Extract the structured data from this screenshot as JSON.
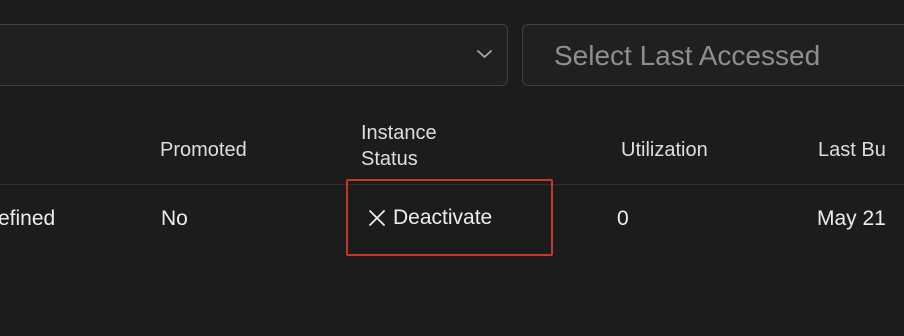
{
  "filters": {
    "first_select": {
      "value": "",
      "icon": "chevron-down-icon"
    },
    "last_accessed": {
      "placeholder": "Select Last Accessed"
    }
  },
  "table": {
    "columns": {
      "promoted": "Promoted",
      "instance_status_line1": "Instance",
      "instance_status_line2": "Status",
      "utilization": "Utilization",
      "last_built": "Last Bu"
    },
    "rows": [
      {
        "type": "efined",
        "promoted": "No",
        "instance_status_action": "Deactivate",
        "instance_status_icon": "close-icon",
        "utilization": "0",
        "last_built": "May 21"
      }
    ]
  },
  "colors": {
    "background": "#1c1c1c",
    "highlight_border": "#c8352b",
    "text": "#ededed",
    "placeholder": "#8e8e8e"
  }
}
